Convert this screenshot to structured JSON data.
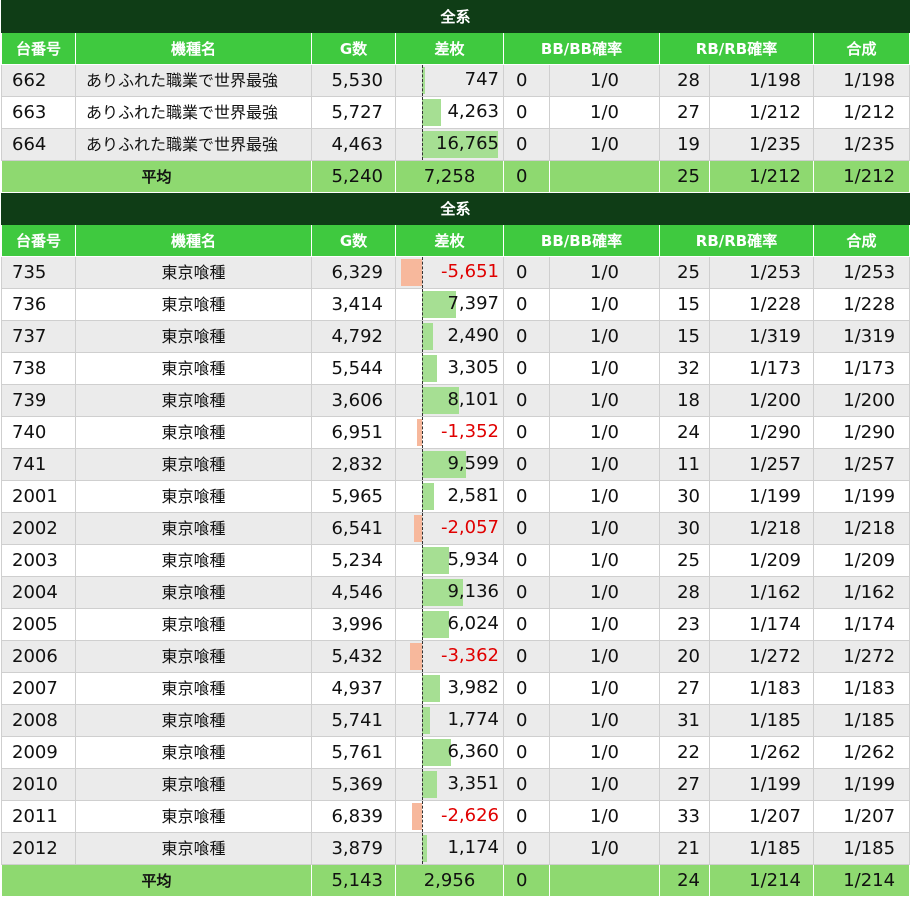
{
  "headers": [
    "台番号",
    "機種名",
    "G数",
    "差枚",
    "BB/BB確率",
    "RB/RB確率",
    "合成"
  ],
  "colors": {
    "title_bg": "#0f3d16",
    "header_bg": "#3fc93f",
    "average_bg": "#8ed970",
    "positive_bar": "#a6df93",
    "negative_bar": "#f7b89c",
    "negative_text": "#e00000"
  },
  "sections": [
    {
      "title": "全系",
      "rows": [
        {
          "no": "662",
          "name": "ありふれた職業で世界最強",
          "g": "5,530",
          "sa": "747",
          "sa_value": 747,
          "bb": "0",
          "bb_prob": "1/0",
          "rb": "28",
          "rb_prob": "1/198",
          "total": "1/198"
        },
        {
          "no": "663",
          "name": "ありふれた職業で世界最強",
          "g": "5,727",
          "sa": "4,263",
          "sa_value": 4263,
          "bb": "0",
          "bb_prob": "1/0",
          "rb": "27",
          "rb_prob": "1/212",
          "total": "1/212"
        },
        {
          "no": "664",
          "name": "ありふれた職業で世界最強",
          "g": "4,463",
          "sa": "16,765",
          "sa_value": 16765,
          "bb": "0",
          "bb_prob": "1/0",
          "rb": "19",
          "rb_prob": "1/235",
          "total": "1/235"
        }
      ],
      "average": {
        "label": "平均",
        "g": "5,240",
        "sa": "7,258",
        "bb": "0",
        "rb": "25",
        "rb_prob": "1/212",
        "total": "1/212"
      }
    },
    {
      "title": "全系",
      "rows": [
        {
          "no": "735",
          "name": "東京喰種",
          "g": "6,329",
          "sa": "-5,651",
          "sa_value": -5651,
          "bb": "0",
          "bb_prob": "1/0",
          "rb": "25",
          "rb_prob": "1/253",
          "total": "1/253"
        },
        {
          "no": "736",
          "name": "東京喰種",
          "g": "3,414",
          "sa": "7,397",
          "sa_value": 7397,
          "bb": "0",
          "bb_prob": "1/0",
          "rb": "15",
          "rb_prob": "1/228",
          "total": "1/228"
        },
        {
          "no": "737",
          "name": "東京喰種",
          "g": "4,792",
          "sa": "2,490",
          "sa_value": 2490,
          "bb": "0",
          "bb_prob": "1/0",
          "rb": "15",
          "rb_prob": "1/319",
          "total": "1/319"
        },
        {
          "no": "738",
          "name": "東京喰種",
          "g": "5,544",
          "sa": "3,305",
          "sa_value": 3305,
          "bb": "0",
          "bb_prob": "1/0",
          "rb": "32",
          "rb_prob": "1/173",
          "total": "1/173"
        },
        {
          "no": "739",
          "name": "東京喰種",
          "g": "3,606",
          "sa": "8,101",
          "sa_value": 8101,
          "bb": "0",
          "bb_prob": "1/0",
          "rb": "18",
          "rb_prob": "1/200",
          "total": "1/200"
        },
        {
          "no": "740",
          "name": "東京喰種",
          "g": "6,951",
          "sa": "-1,352",
          "sa_value": -1352,
          "bb": "0",
          "bb_prob": "1/0",
          "rb": "24",
          "rb_prob": "1/290",
          "total": "1/290"
        },
        {
          "no": "741",
          "name": "東京喰種",
          "g": "2,832",
          "sa": "9,599",
          "sa_value": 9599,
          "bb": "0",
          "bb_prob": "1/0",
          "rb": "11",
          "rb_prob": "1/257",
          "total": "1/257"
        },
        {
          "no": "2001",
          "name": "東京喰種",
          "g": "5,965",
          "sa": "2,581",
          "sa_value": 2581,
          "bb": "0",
          "bb_prob": "1/0",
          "rb": "30",
          "rb_prob": "1/199",
          "total": "1/199"
        },
        {
          "no": "2002",
          "name": "東京喰種",
          "g": "6,541",
          "sa": "-2,057",
          "sa_value": -2057,
          "bb": "0",
          "bb_prob": "1/0",
          "rb": "30",
          "rb_prob": "1/218",
          "total": "1/218"
        },
        {
          "no": "2003",
          "name": "東京喰種",
          "g": "5,234",
          "sa": "5,934",
          "sa_value": 5934,
          "bb": "0",
          "bb_prob": "1/0",
          "rb": "25",
          "rb_prob": "1/209",
          "total": "1/209"
        },
        {
          "no": "2004",
          "name": "東京喰種",
          "g": "4,546",
          "sa": "9,136",
          "sa_value": 9136,
          "bb": "0",
          "bb_prob": "1/0",
          "rb": "28",
          "rb_prob": "1/162",
          "total": "1/162"
        },
        {
          "no": "2005",
          "name": "東京喰種",
          "g": "3,996",
          "sa": "6,024",
          "sa_value": 6024,
          "bb": "0",
          "bb_prob": "1/0",
          "rb": "23",
          "rb_prob": "1/174",
          "total": "1/174"
        },
        {
          "no": "2006",
          "name": "東京喰種",
          "g": "5,432",
          "sa": "-3,362",
          "sa_value": -3362,
          "bb": "0",
          "bb_prob": "1/0",
          "rb": "20",
          "rb_prob": "1/272",
          "total": "1/272"
        },
        {
          "no": "2007",
          "name": "東京喰種",
          "g": "4,937",
          "sa": "3,982",
          "sa_value": 3982,
          "bb": "0",
          "bb_prob": "1/0",
          "rb": "27",
          "rb_prob": "1/183",
          "total": "1/183"
        },
        {
          "no": "2008",
          "name": "東京喰種",
          "g": "5,741",
          "sa": "1,774",
          "sa_value": 1774,
          "bb": "0",
          "bb_prob": "1/0",
          "rb": "31",
          "rb_prob": "1/185",
          "total": "1/185"
        },
        {
          "no": "2009",
          "name": "東京喰種",
          "g": "5,761",
          "sa": "6,360",
          "sa_value": 6360,
          "bb": "0",
          "bb_prob": "1/0",
          "rb": "22",
          "rb_prob": "1/262",
          "total": "1/262"
        },
        {
          "no": "2010",
          "name": "東京喰種",
          "g": "5,369",
          "sa": "3,351",
          "sa_value": 3351,
          "bb": "0",
          "bb_prob": "1/0",
          "rb": "27",
          "rb_prob": "1/199",
          "total": "1/199"
        },
        {
          "no": "2011",
          "name": "東京喰種",
          "g": "6,839",
          "sa": "-2,626",
          "sa_value": -2626,
          "bb": "0",
          "bb_prob": "1/0",
          "rb": "33",
          "rb_prob": "1/207",
          "total": "1/207"
        },
        {
          "no": "2012",
          "name": "東京喰種",
          "g": "3,879",
          "sa": "1,174",
          "sa_value": 1174,
          "bb": "0",
          "bb_prob": "1/0",
          "rb": "21",
          "rb_prob": "1/185",
          "total": "1/185"
        }
      ],
      "average": {
        "label": "平均",
        "g": "5,143",
        "sa": "2,956",
        "bb": "0",
        "rb": "24",
        "rb_prob": "1/214",
        "total": "1/214"
      }
    }
  ]
}
